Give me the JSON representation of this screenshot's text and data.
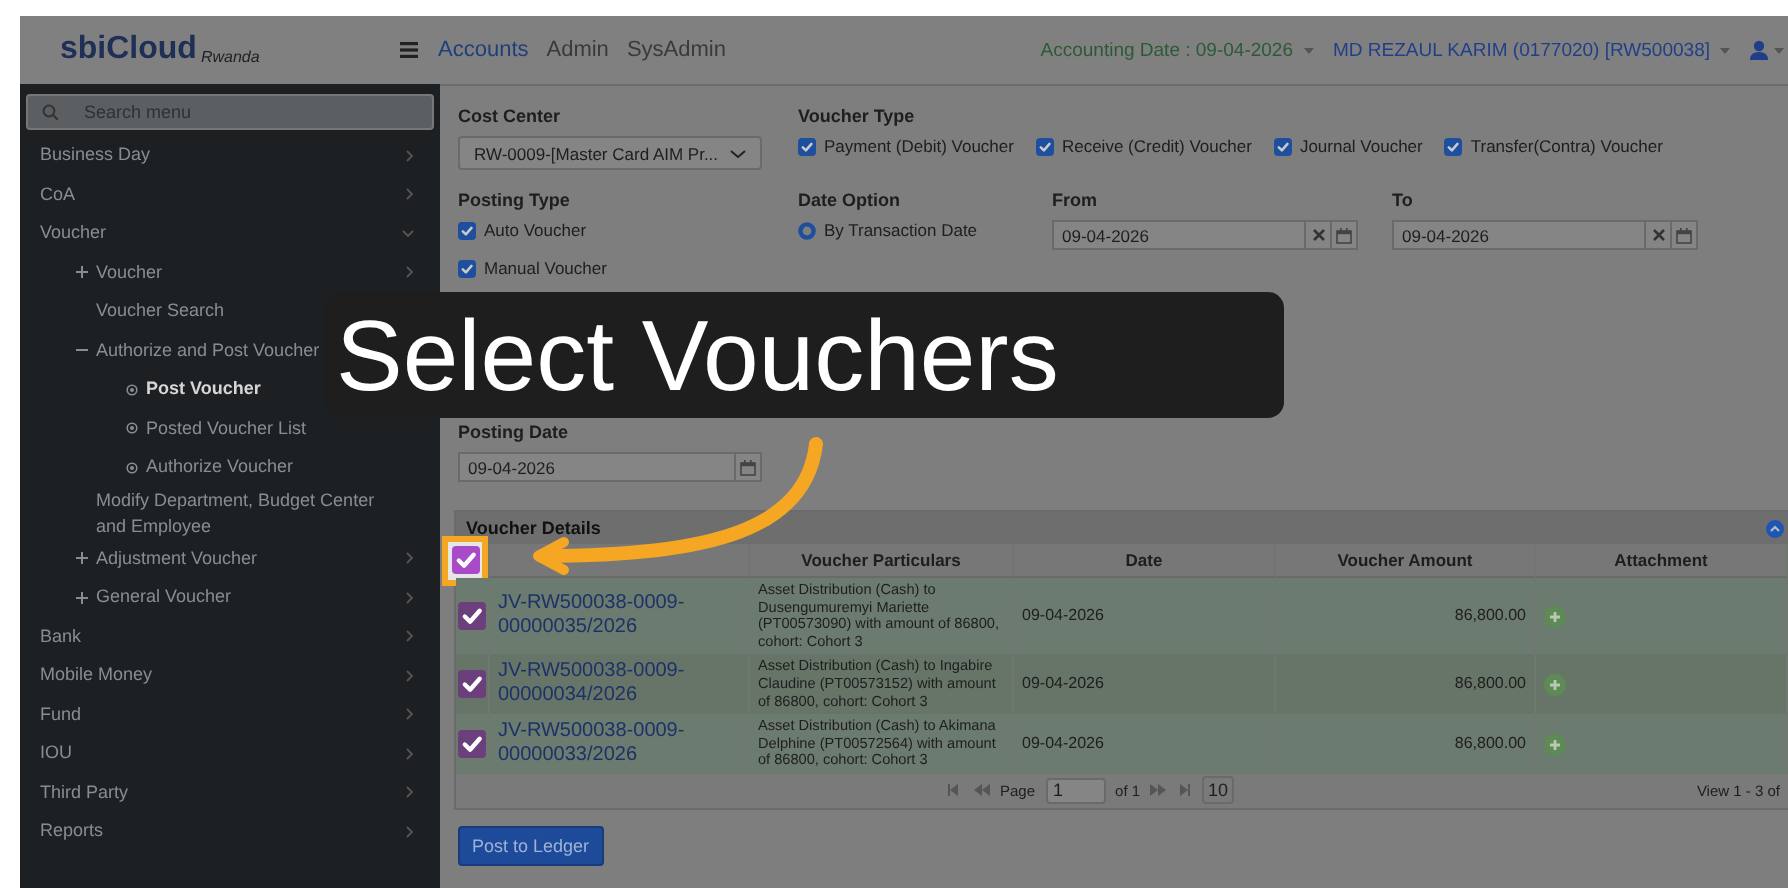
{
  "header": {
    "logo": "sbiCloud",
    "logo_sub": "Rwanda",
    "nav": [
      {
        "label": "Accounts",
        "selected": true
      },
      {
        "label": "Admin",
        "selected": false
      },
      {
        "label": "SysAdmin",
        "selected": false
      }
    ],
    "accounting_date": "Accounting Date : 09-04-2026",
    "user": "MD REZAUL KARIM (0177020) [RW500038]"
  },
  "sidebar": {
    "search": {
      "placeholder": "Search menu"
    },
    "items": [
      {
        "label": "Business Day",
        "kind": "group",
        "expanded": false,
        "selected": false
      },
      {
        "label": "CoA",
        "kind": "group",
        "expanded": false,
        "selected": false
      },
      {
        "label": "Voucher",
        "kind": "group",
        "expanded": true,
        "selected": false,
        "children": [
          {
            "label": "Voucher",
            "kind": "group",
            "expanded": false,
            "selected": false
          },
          {
            "label": "Voucher Search",
            "kind": "link",
            "selected": false
          },
          {
            "label": "Authorize and Post Voucher",
            "kind": "group",
            "expanded": true,
            "selected": false,
            "children": [
              {
                "label": "Post Voucher",
                "kind": "link",
                "selected": true
              },
              {
                "label": "Posted Voucher List",
                "kind": "link",
                "selected": false
              },
              {
                "label": "Authorize Voucher",
                "kind": "link",
                "selected": false
              }
            ]
          },
          {
            "label": "Modify Department, Budget Center and Employee",
            "kind": "link",
            "selected": false
          },
          {
            "label": "Adjustment Voucher",
            "kind": "group",
            "expanded": false,
            "selected": false
          },
          {
            "label": "General Voucher",
            "kind": "group",
            "expanded": false,
            "selected": false
          }
        ]
      },
      {
        "label": "Bank",
        "kind": "group",
        "expanded": false,
        "selected": false
      },
      {
        "label": "Mobile Money",
        "kind": "group",
        "expanded": false,
        "selected": false
      },
      {
        "label": "Fund",
        "kind": "group",
        "expanded": false,
        "selected": false
      },
      {
        "label": "IOU",
        "kind": "group",
        "expanded": false,
        "selected": false
      },
      {
        "label": "Third Party",
        "kind": "group",
        "expanded": false,
        "selected": false
      },
      {
        "label": "Reports",
        "kind": "group",
        "expanded": false,
        "selected": false
      }
    ]
  },
  "form": {
    "cost_center": {
      "label": "Cost Center",
      "value": "RW-0009-[Master Card AIM Pr..."
    },
    "voucher_type": {
      "label": "Voucher Type",
      "options": [
        {
          "label": "Payment (Debit) Voucher",
          "checked": true
        },
        {
          "label": "Receive (Credit) Voucher",
          "checked": true
        },
        {
          "label": "Journal Voucher",
          "checked": true
        },
        {
          "label": "Transfer(Contra) Voucher",
          "checked": true
        }
      ]
    },
    "posting_type": {
      "label": "Posting Type",
      "options": [
        {
          "label": "Auto Voucher",
          "checked": true
        },
        {
          "label": "Manual Voucher",
          "checked": true
        }
      ]
    },
    "date_option": {
      "label": "Date Option",
      "options": [
        {
          "label": "By Transaction Date",
          "selected": true
        }
      ]
    },
    "from": {
      "label": "From",
      "value": "09-04-2026"
    },
    "to": {
      "label": "To",
      "value": "09-04-2026"
    },
    "posting_date": {
      "label": "Posting Date",
      "value": "09-04-2026"
    }
  },
  "voucher_details": {
    "title": "Voucher Details",
    "select_all": {
      "checked": true
    },
    "columns": [
      "Voucher Particulars",
      "Date",
      "Voucher Amount",
      "Attachment"
    ],
    "rows": [
      {
        "selected": true,
        "voucher_no": "JV-RW500038-0009-00000035/2026",
        "particulars": "Asset Distribution (Cash) to Dusengumuremyi Mariette (PT00573090) with amount of 86800, cohort: Cohort 3",
        "date": "09-04-2026",
        "amount": "86,800.00"
      },
      {
        "selected": true,
        "voucher_no": "JV-RW500038-0009-00000034/2026",
        "particulars": "Asset Distribution (Cash) to Ingabire Claudine (PT00573152) with amount of 86800, cohort: Cohort 3",
        "date": "09-04-2026",
        "amount": "86,800.00"
      },
      {
        "selected": true,
        "voucher_no": "JV-RW500038-0009-00000033/2026",
        "particulars": "Asset Distribution (Cash) to Akimana Delphine (PT00572564) with amount of 86800, cohort: Cohort 3",
        "date": "09-04-2026",
        "amount": "86,800.00"
      }
    ],
    "pager": {
      "page_label": "Page",
      "page": "1",
      "of": "of 1",
      "page_size": "10",
      "view": "View 1 - 3 of"
    }
  },
  "post_button": "Post to Ledger",
  "callout": {
    "text": "Select Vouchers"
  }
}
